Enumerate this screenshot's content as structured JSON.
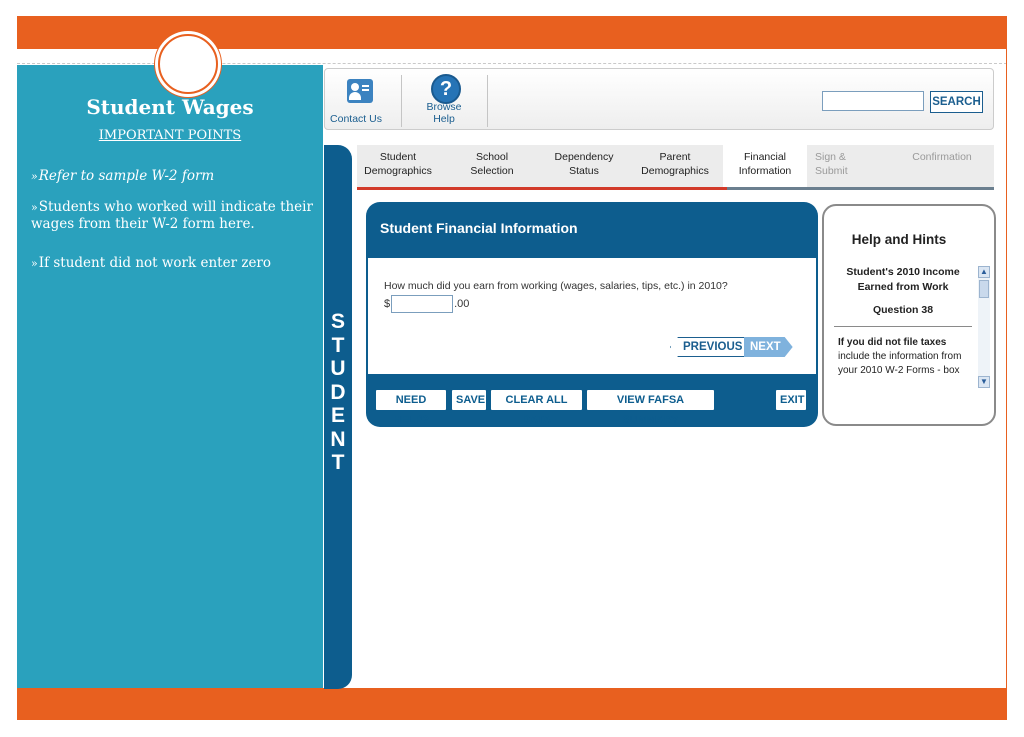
{
  "colors": {
    "accent": "#e8601f",
    "teal": "#2aa1bd",
    "navy": "#0d5d8e"
  },
  "sidebar": {
    "title": "Student Wages",
    "subtitle": "IMPORTANT POINTS",
    "bullets": [
      "Refer to sample W-2 form",
      "Students who worked will indicate their wages from their W-2 form here.",
      "If student did not work enter zero"
    ],
    "bullet_mark": "»"
  },
  "vertical_label": [
    "S",
    "T",
    "U",
    "D",
    "E",
    "N",
    "T"
  ],
  "toolbar": {
    "contact_label": "Contact Us",
    "help_label": "Browse Help",
    "search_label": "SEARCH",
    "search_value": ""
  },
  "tabs": [
    {
      "line1": "Student",
      "line2": "Demographics",
      "state": "done"
    },
    {
      "line1": "School",
      "line2": "Selection",
      "state": "done"
    },
    {
      "line1": "Dependency",
      "line2": "Status",
      "state": "done"
    },
    {
      "line1": "Parent",
      "line2": "Demographics",
      "state": "done"
    },
    {
      "line1": "Financial",
      "line2": "Information",
      "state": "active"
    },
    {
      "line1": "Sign &",
      "line2": "Submit",
      "state": "disabled"
    },
    {
      "line1": "Confirmation",
      "line2": "",
      "state": "disabled"
    }
  ],
  "form": {
    "title": "Student Financial Information",
    "question": "How much did you earn from working (wages, salaries, tips, etc.) in 2010?",
    "currency": "$",
    "amount_value": "",
    "cents": ".00",
    "previous_label": "PREVIOUS",
    "next_label": "NEXT"
  },
  "actions": {
    "need_help": "NEED HELP?",
    "save": "SAVE",
    "clear": "CLEAR ALL DATA",
    "summary": "VIEW FAFSA SUMMARY",
    "exit": "EXIT"
  },
  "help": {
    "title": "Help and Hints",
    "topic_line1": "Student's 2010 Income",
    "topic_line2": "Earned from Work",
    "question": "Question 38",
    "text_bold": "If you did not file taxes",
    "text_rest": "include the information from your 2010 W-2 Forms - box"
  }
}
